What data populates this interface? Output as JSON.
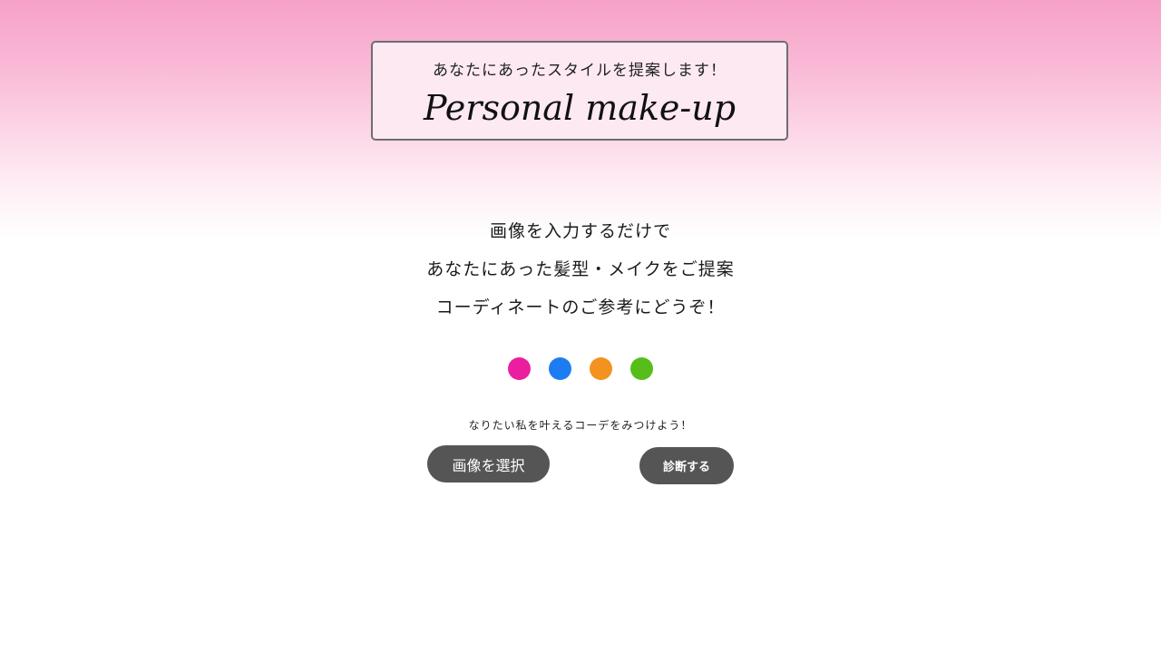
{
  "header": {
    "subtitle": "あなたにあったスタイルを提案します！",
    "title": "Personal make-up"
  },
  "intro": {
    "line1": "画像を入力するだけで",
    "line2": "あなたにあった髪型・メイクをご提案",
    "line3": "コーディネートのご参考にどうぞ！"
  },
  "dots": [
    {
      "color": "#ec1ea0"
    },
    {
      "color": "#1e7cf2"
    },
    {
      "color": "#f3921f"
    },
    {
      "color": "#56bd1a"
    }
  ],
  "tagline": "なりたい私を叶えるコーデをみつけよう！",
  "buttons": {
    "select_image": "画像を選択",
    "diagnose": "診断する"
  },
  "colors": {
    "gradient_top": "#f7a1c8",
    "header_bg": "#fde9f2",
    "button_bg": "#555555"
  }
}
